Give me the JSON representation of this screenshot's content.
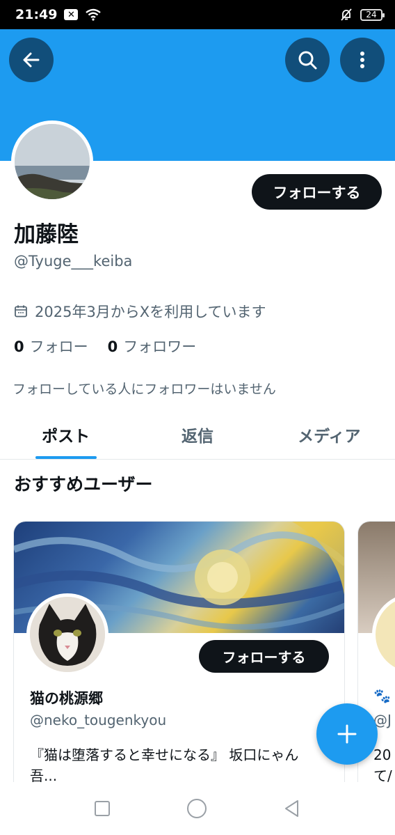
{
  "status_bar": {
    "time": "21:49",
    "battery": "24"
  },
  "header": {
    "back_icon": "arrow-left-icon",
    "search_icon": "search-icon",
    "more_icon": "more-vertical-icon",
    "banner_color": "#1d9bf0"
  },
  "profile": {
    "name": "加藤陸",
    "handle": "@Tyuge___keiba",
    "follow_button": "フォローする",
    "joined": "2025年3月からXを利用しています",
    "following_count": "0",
    "following_label": "フォロー",
    "followers_count": "0",
    "followers_label": "フォロワー",
    "no_followers_note": "フォローしている人にフォロワーはいません"
  },
  "tabs": [
    {
      "label": "ポスト",
      "active": true
    },
    {
      "label": "返信",
      "active": false
    },
    {
      "label": "メディア",
      "active": false
    }
  ],
  "suggestions": {
    "title": "おすすめユーザー",
    "cards": [
      {
        "name": "猫の桃源郷",
        "handle": "@neko_tougenkyou",
        "follow_button": "フォローする",
        "bio": "『猫は堕落すると幸せになる』 坂口にゃん吾..."
      }
    ],
    "partial_card": {
      "handle_fragment": "@J",
      "bio_fragment_line1": "20",
      "bio_fragment_line2": "て/"
    }
  },
  "fab": {
    "icon": "plus-icon"
  },
  "accent_color": "#1d9bf0"
}
